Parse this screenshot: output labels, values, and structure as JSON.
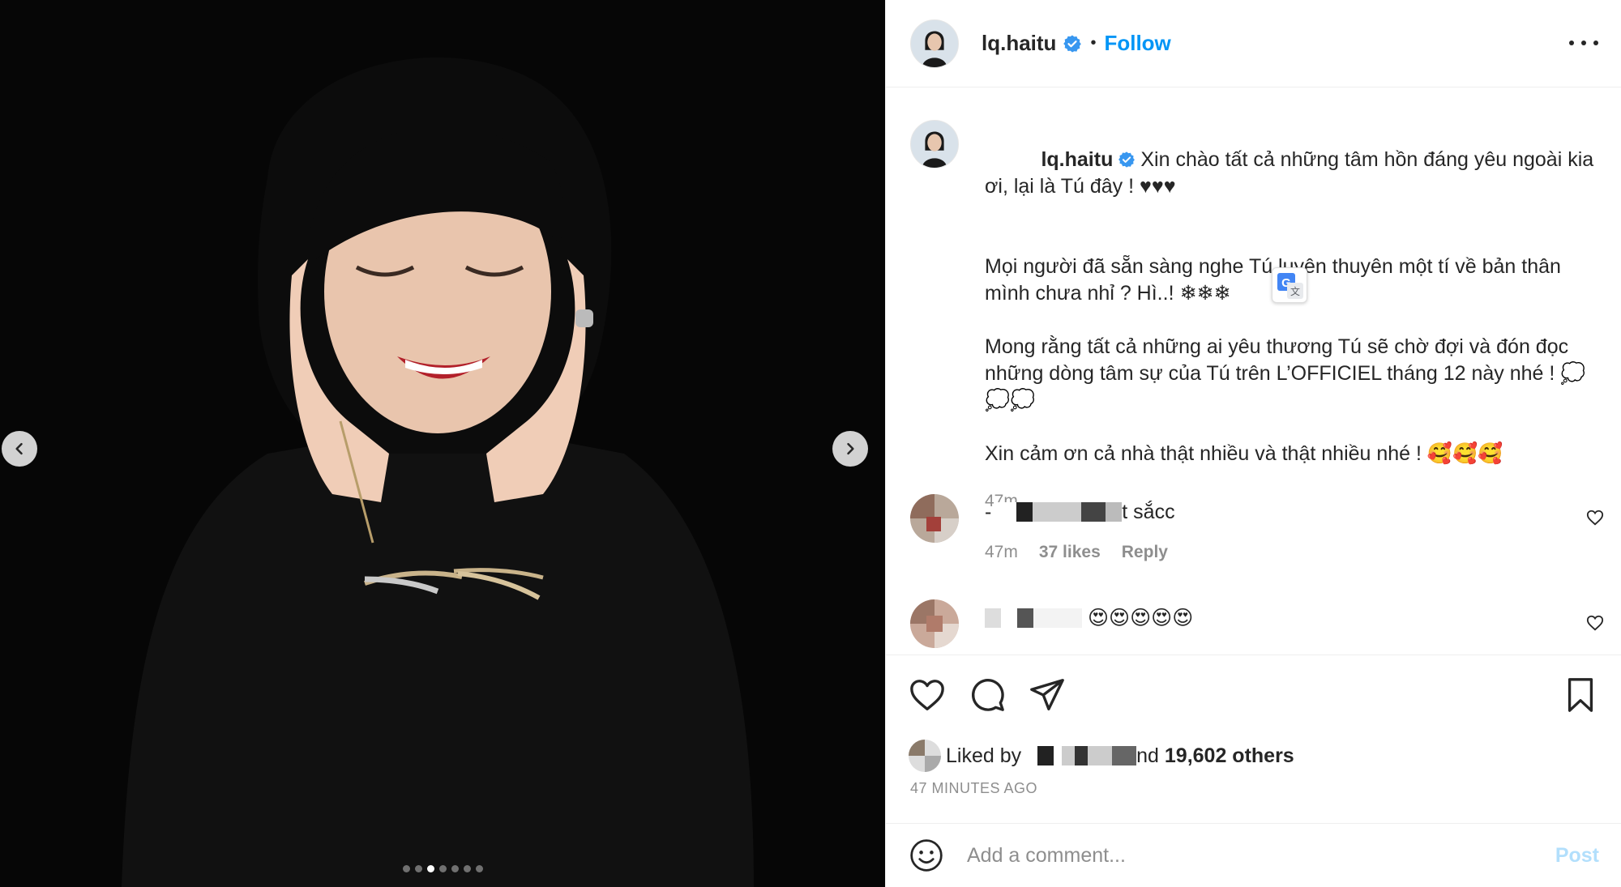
{
  "post": {
    "username": "lq.haitu",
    "follow_label": "Follow",
    "bullet": "•",
    "caption": {
      "paragraphs": [
        "Xin chào tất cả những tâm hồn đáng yêu ngoài kia ơi, lại là Tú đây ! ♥♥♥",
        "Mọi người đã sẵn sàng nghe Tú luyên thuyên một tí về bản thân mình chưa nhỉ ? Hì..! ❄❄❄",
        "Mong rằng tất cả những ai yêu thương Tú sẽ chờ đợi và đón đọc những dòng tâm sự của Tú trên L’OFFICIEL tháng 12 này nhé ! 💭💭💭",
        "Xin cảm ơn cả nhà thật nhiều và thật nhiều nhé ! 🥰🥰🥰"
      ],
      "time": "47m"
    },
    "comments": [
      {
        "text_prefix": "-",
        "text_suffix": "t sắcc",
        "time": "47m",
        "likes": "37 likes",
        "reply": "Reply"
      },
      {
        "text_suffix": "😍😍😍😍😍"
      }
    ],
    "liked_by_prefix": "Liked by",
    "liked_by_suffix": "nd",
    "liked_by_count": "19,602 others",
    "time_ago": "47 MINUTES AGO",
    "comment_placeholder": "Add a comment...",
    "post_label": "Post",
    "carousel": {
      "total": 7,
      "active_index": 2
    }
  },
  "icons": {
    "prev": "chevron-left-icon",
    "next": "chevron-right-icon",
    "more": "more-options-icon",
    "like": "heart-icon",
    "comment": "comment-icon",
    "share": "share-icon",
    "save": "bookmark-icon",
    "emoji": "emoji-icon",
    "verified": "verified-badge-icon",
    "translate": "translate-icon"
  },
  "colors": {
    "accent": "#0095f6",
    "post_disabled": "#b2dffc",
    "muted": "#8e8e8e"
  }
}
